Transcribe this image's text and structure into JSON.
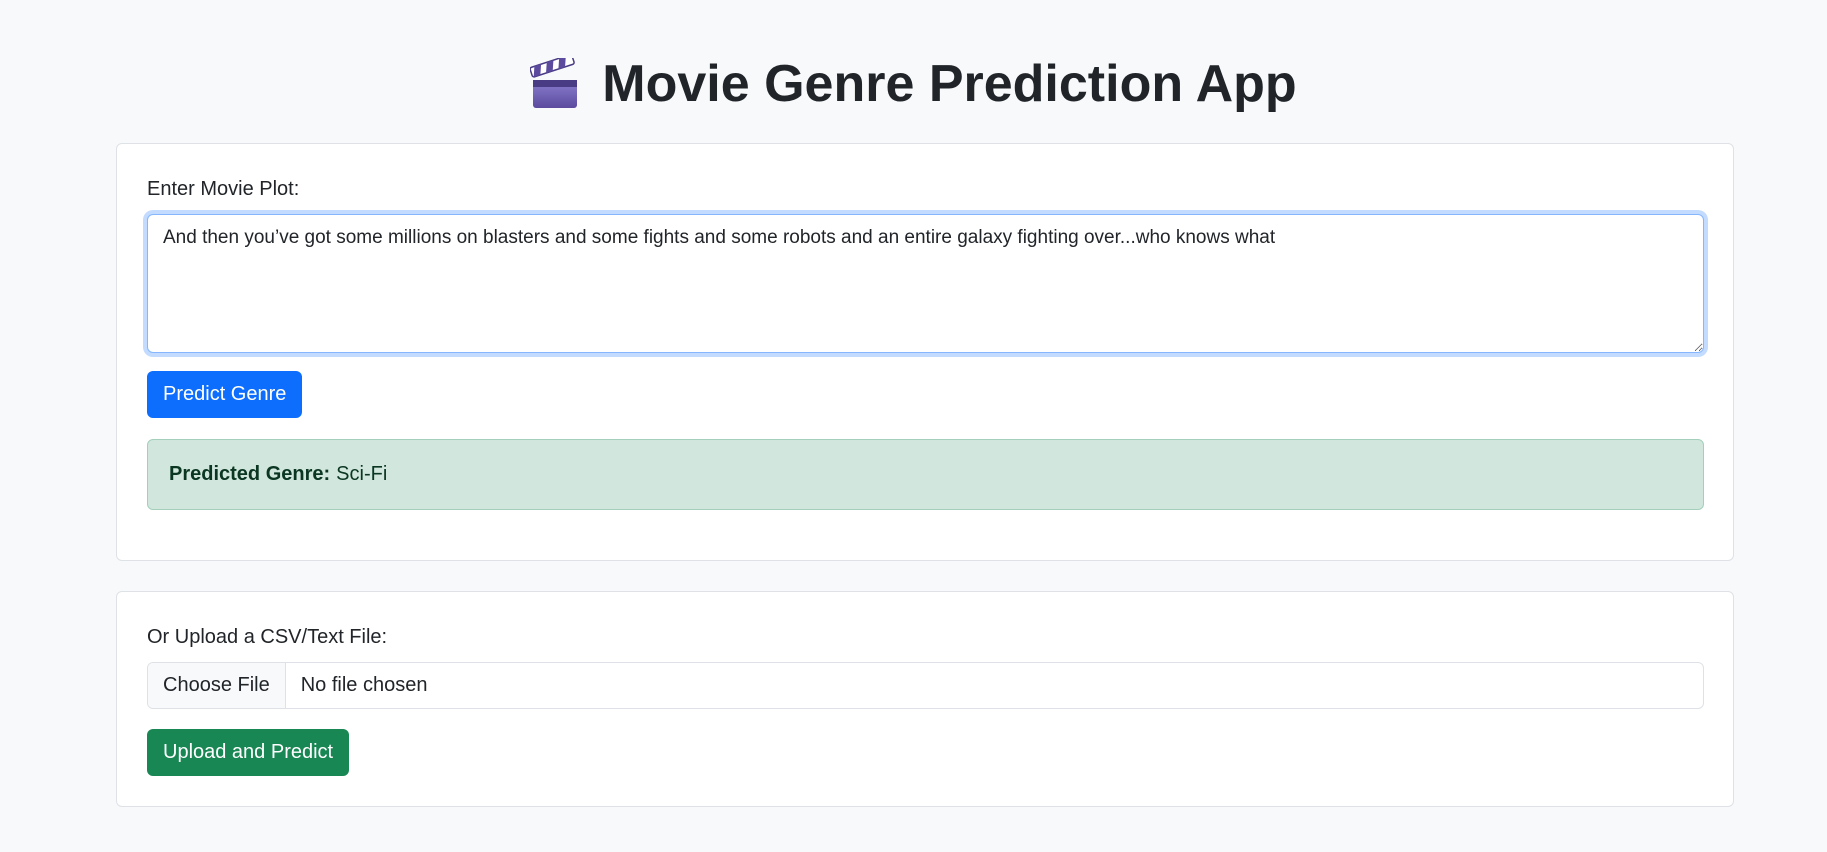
{
  "header": {
    "icon": "clapper-board-icon",
    "title": "Movie Genre Prediction App"
  },
  "plot_form": {
    "label": "Enter Movie Plot:",
    "textarea_value": "And then you’ve got some millions on blasters and some fights and some robots and an entire galaxy fighting over...who knows what",
    "predict_button": "Predict Genre",
    "result": {
      "label": "Predicted Genre:",
      "value": "Sci-Fi"
    }
  },
  "upload_form": {
    "label": "Or Upload a CSV/Text File:",
    "choose_file_button": "Choose File",
    "file_status": "No file chosen",
    "upload_button": "Upload and Predict"
  },
  "colors": {
    "primary": "#0d6efd",
    "success": "#198754",
    "alert_background": "#d1e7dd",
    "page_background": "#f8f9fa"
  }
}
